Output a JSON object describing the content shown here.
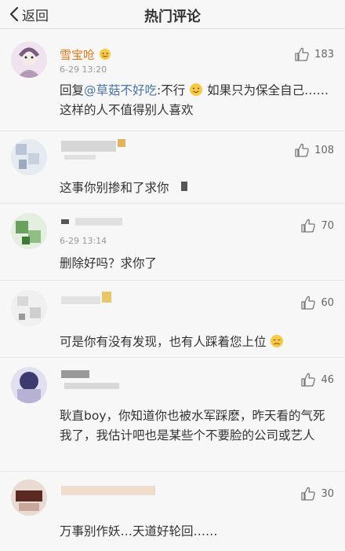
{
  "nav": {
    "back_label": "返回",
    "title": "热门评论"
  },
  "comments": [
    {
      "name": "雪宝呛",
      "time": "6-29 13:20",
      "likes": "183",
      "text_prefix": "回复",
      "mention": "@草菇不好吃",
      "text": ":不行",
      "text_rest": "如果只为保全自己……这样的人不值得别人喜欢"
    },
    {
      "likes": "108",
      "text": "这事你别掺和了求你"
    },
    {
      "time": "6-29 13:14",
      "likes": "70",
      "text": "删除好吗？求你了"
    },
    {
      "likes": "60",
      "text": "可是你有没有发现，也有人踩着您上位"
    },
    {
      "likes": "46",
      "text": "耿直boy，你知道你也被水军踩麽，昨天看的气死我了，我估计吧也是某些个不要脸的公司或艺人"
    },
    {
      "likes": "30",
      "text": "万事别作妖…天道好轮回……"
    }
  ],
  "icons": {
    "back": "chevron-left-icon",
    "like": "thumbs-up-icon",
    "emoji": "smile-emoji-icon"
  },
  "colors": {
    "name": "#e87a1e",
    "mention": "#4a76a8"
  }
}
